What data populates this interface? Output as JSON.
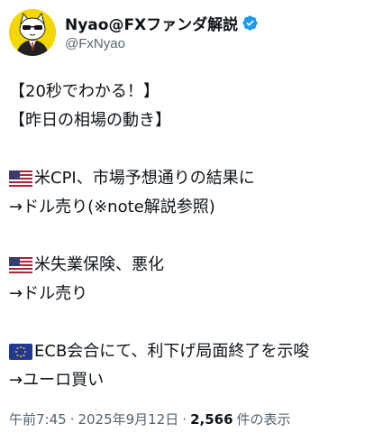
{
  "author": {
    "display_name": "Nyao@FXファンダ解説",
    "handle": "@FxNyao",
    "verified": true,
    "avatar_icon": "cat-in-suit-avatar"
  },
  "tweet": {
    "lines": [
      {
        "text": "【20秒でわかる！】"
      },
      {
        "text": "【昨日の相場の動き】"
      },
      {
        "text": ""
      },
      {
        "flag": "us-flag-icon",
        "text": "米CPI、市場予想通りの結果に"
      },
      {
        "text": "→ドル売り(※note解説参照)"
      },
      {
        "text": ""
      },
      {
        "flag": "us-flag-icon",
        "text": "米失業保険、悪化"
      },
      {
        "text": "→ドル売り"
      },
      {
        "text": ""
      },
      {
        "flag": "eu-flag-icon",
        "text": "ECB会合にて、利下げ局面終了を示唆"
      },
      {
        "text": "→ユーロ買い"
      }
    ]
  },
  "meta": {
    "time": "午前7:45",
    "separator": "·",
    "date": "2025年9月12日",
    "views_count": "2,566",
    "views_label": "件の表示"
  },
  "colors": {
    "verified": "#1d9bf0",
    "secondary_text": "#536471",
    "avatar_bg": "#f4d600"
  }
}
